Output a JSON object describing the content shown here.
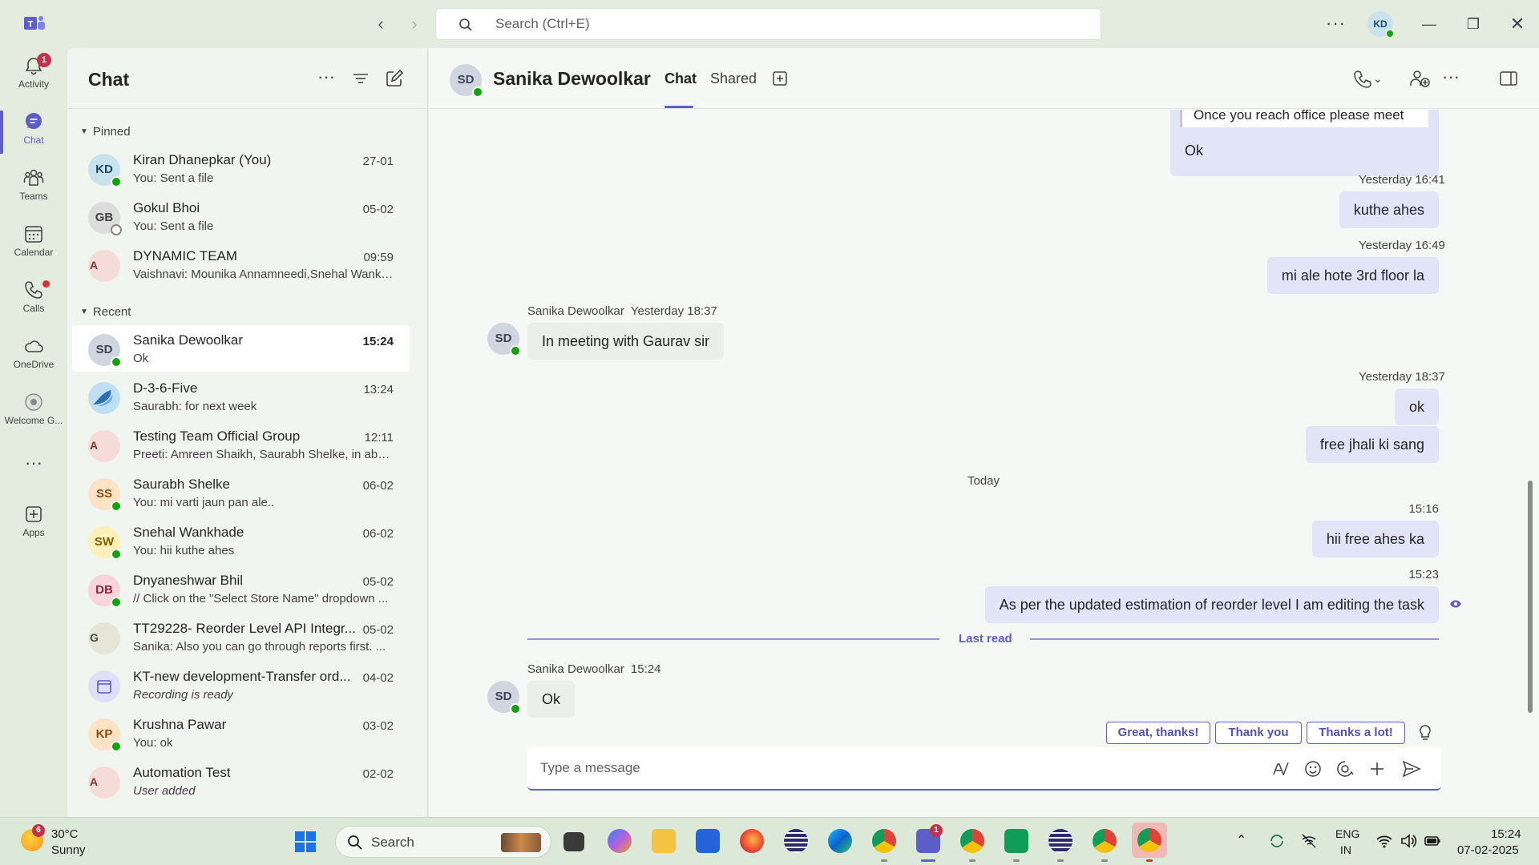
{
  "titlebar": {
    "search_placeholder": "Search (Ctrl+E)",
    "user_initials": "KD"
  },
  "rail": {
    "items": [
      {
        "label": "Activity",
        "icon": "bell-icon",
        "badge": "1"
      },
      {
        "label": "Chat",
        "icon": "chat-icon"
      },
      {
        "label": "Teams",
        "icon": "teams-icon"
      },
      {
        "label": "Calendar",
        "icon": "calendar-icon"
      },
      {
        "label": "Calls",
        "icon": "phone-icon"
      },
      {
        "label": "OneDrive",
        "icon": "cloud-icon"
      },
      {
        "label": "Welcome G...",
        "icon": "welcome-icon"
      },
      {
        "label": "Apps",
        "icon": "apps-icon"
      }
    ]
  },
  "chatlist": {
    "title": "Chat",
    "pinned_label": "Pinned",
    "recent_label": "Recent",
    "pinned": [
      {
        "initials": "KD",
        "name": "Kiran Dhanepkar (You)",
        "preview": "You: Sent a file",
        "time": "27-01"
      },
      {
        "initials": "GB",
        "name": "Gokul Bhoi",
        "preview": "You: Sent a file",
        "time": "05-02"
      },
      {
        "initials": "A",
        "name": "DYNAMIC TEAM",
        "preview": "Vaishnavi: Mounika Annamneedi,Snehal Wankh...",
        "time": "09:59"
      }
    ],
    "recent": [
      {
        "initials": "SD",
        "name": "Sanika Dewoolkar",
        "preview": "Ok",
        "time": "15:24"
      },
      {
        "initials": "",
        "name": "D-3-6-Five",
        "preview": "Saurabh: for next week",
        "time": "13:24"
      },
      {
        "initials": "A",
        "name": "Testing Team Official Group",
        "preview": "Preeti: Amreen Shaikh, Saurabh Shelke, in abse...",
        "time": "12:11"
      },
      {
        "initials": "SS",
        "name": "Saurabh Shelke",
        "preview": "You: mi varti jaun pan ale..",
        "time": "06-02"
      },
      {
        "initials": "SW",
        "name": "Snehal Wankhade",
        "preview": "You: hii kuthe ahes",
        "time": "06-02"
      },
      {
        "initials": "DB",
        "name": "Dnyaneshwar Bhil",
        "preview": "// Click on the \"Select Store Name\" dropdown ...",
        "time": "05-02"
      },
      {
        "initials": "G",
        "name": "TT29228- Reorder Level API Integr...",
        "preview": "Sanika: Also you can go through reports first. ...",
        "time": "05-02"
      },
      {
        "initials": "",
        "name": "KT-new development-Transfer ord...",
        "preview": "Recording is ready",
        "time": "04-02"
      },
      {
        "initials": "KP",
        "name": "Krushna Pawar",
        "preview": "You: ok",
        "time": "03-02"
      },
      {
        "initials": "A",
        "name": "Automation Test",
        "preview": "User added",
        "time": "02-02"
      }
    ]
  },
  "conversation": {
    "initials": "SD",
    "name": "Sanika Dewoolkar",
    "tabs": [
      "Chat",
      "Shared"
    ],
    "quote_text": "Once you reach office please meet",
    "messages": {
      "out_ok": "Ok",
      "t1": "Yesterday 16:41",
      "m1": "kuthe ahes",
      "t2": "Yesterday 16:49",
      "m2": "mi ale hote 3rd floor la",
      "in1_name": "Sanika Dewoolkar",
      "in1_time": "Yesterday 18:37",
      "in1_text": "In meeting with Gaurav sir",
      "t3": "Yesterday 18:37",
      "m3": "ok",
      "m4": "free jhali ki sang",
      "day": "Today",
      "t4": "15:16",
      "m5": "hii free ahes ka",
      "t5": "15:23",
      "m6": "As per the updated estimation of reorder level I am editing the task",
      "last_read": "Last read",
      "in2_name": "Sanika Dewoolkar",
      "in2_time": "15:24",
      "in2_text": "Ok"
    },
    "suggestions": [
      "Great, thanks!",
      "Thank you",
      "Thanks a lot!"
    ],
    "composer_placeholder": "Type a message"
  },
  "taskbar": {
    "weather_badge": "6",
    "weather_temp": "30°C",
    "weather_cond": "Sunny",
    "search_label": "Search",
    "teams_badge": "1",
    "lang_top": "ENG",
    "lang_bottom": "IN",
    "time": "15:24",
    "date": "07-02-2025"
  },
  "colors": {
    "accent": "#5b5fc7",
    "presence_available": "#13a10e",
    "badge": "#c4314b"
  }
}
